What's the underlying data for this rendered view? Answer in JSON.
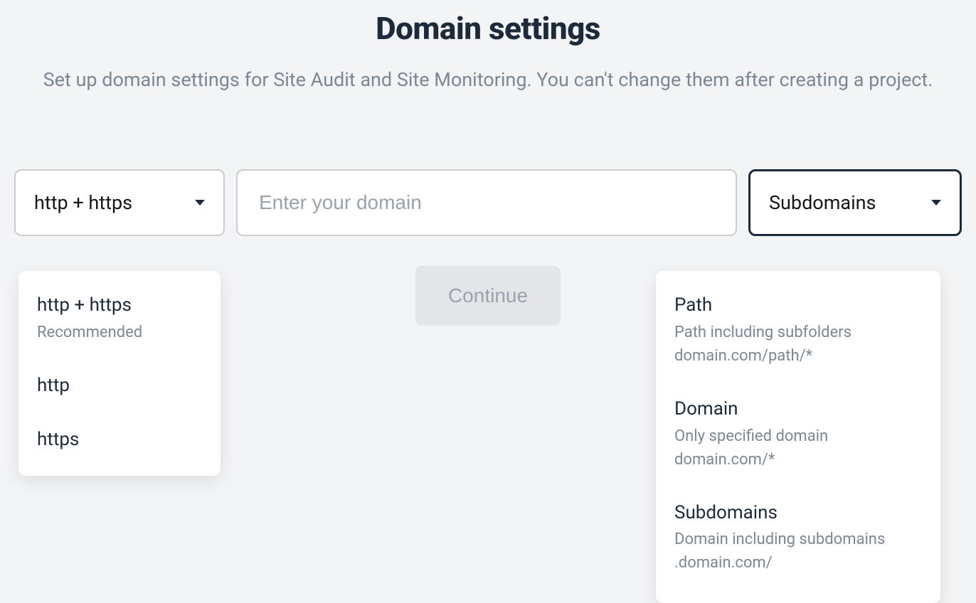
{
  "header": {
    "title": "Domain settings",
    "subtitle": "Set up domain settings for Site Audit and Site Monitoring. You can't change them after creating a project."
  },
  "form": {
    "protocol_select": {
      "selected": "http + https",
      "options": [
        {
          "label": "http + https",
          "sub": "Recommended"
        },
        {
          "label": "http",
          "sub": ""
        },
        {
          "label": "https",
          "sub": ""
        }
      ]
    },
    "domain_input": {
      "placeholder": "Enter your domain",
      "value": ""
    },
    "crawl_select": {
      "selected": "Subdomains",
      "options": [
        {
          "label": "Path",
          "sub": "Path including subfolders domain.com/path/*"
        },
        {
          "label": "Domain",
          "sub": "Only specified domain domain.com/*"
        },
        {
          "label": "Subdomains",
          "sub": "Domain including subdomains .domain.com/"
        }
      ]
    },
    "continue_label": "Continue"
  }
}
